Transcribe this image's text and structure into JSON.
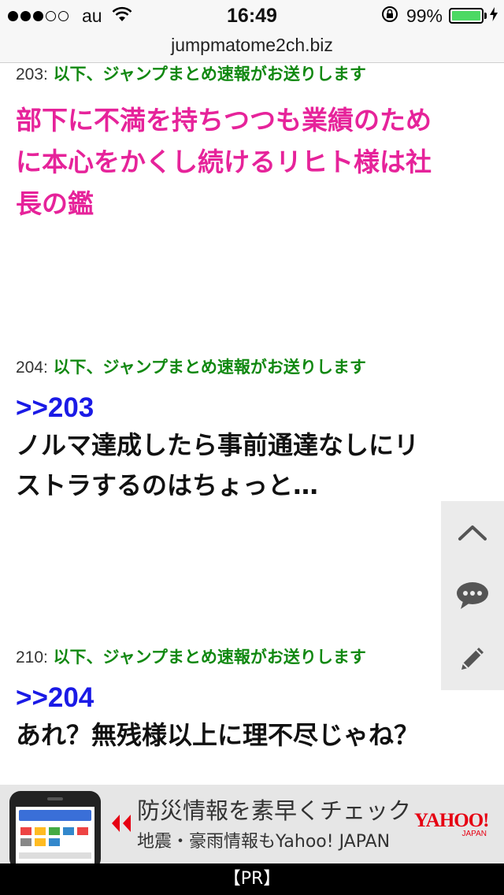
{
  "status_bar": {
    "carrier": "au",
    "time": "16:49",
    "battery_percent": "99%",
    "battery_level": 0.99,
    "signal_bars_filled": 3,
    "signal_bars_total": 5,
    "battery_color": "#4cd964"
  },
  "browser": {
    "url": "jumpmatome2ch.biz"
  },
  "posts": [
    {
      "num": "203:",
      "name": "以下、ジャンプまとめ速報がお送りします",
      "lines": [
        "部下に不満を持ちつつも業績のため",
        "に本心をかくし続けるリヒト様は社",
        "長の鑑"
      ]
    },
    {
      "num": "204:",
      "name": "以下、ジャンプまとめ速報がお送りします",
      "reply": ">>203",
      "lines": [
        "ノルマ達成したら事前通達なしにリ",
        "ストラするのはちょっと…"
      ]
    },
    {
      "num": "210:",
      "name": "以下、ジャンプまとめ速報がお送りします",
      "reply": ">>204",
      "lines": [
        "あれ？無残様以上に理不尽じゃね？"
      ]
    }
  ],
  "side_menu": {
    "icons": [
      "chevron-up-icon",
      "comment-bubble-icon",
      "pencil-icon"
    ]
  },
  "ad": {
    "title": "防災情報を素早くチェック",
    "subtitle": "地震・豪雨情報もYahoo! JAPAN",
    "logo": "YAHOO!",
    "logo_sub": "JAPAN",
    "label": "【PR】",
    "accent_color": "#e60012"
  },
  "colors": {
    "name_green": "#118811",
    "pink_text": "#e6239a",
    "reply_blue": "#1a1ae6"
  }
}
